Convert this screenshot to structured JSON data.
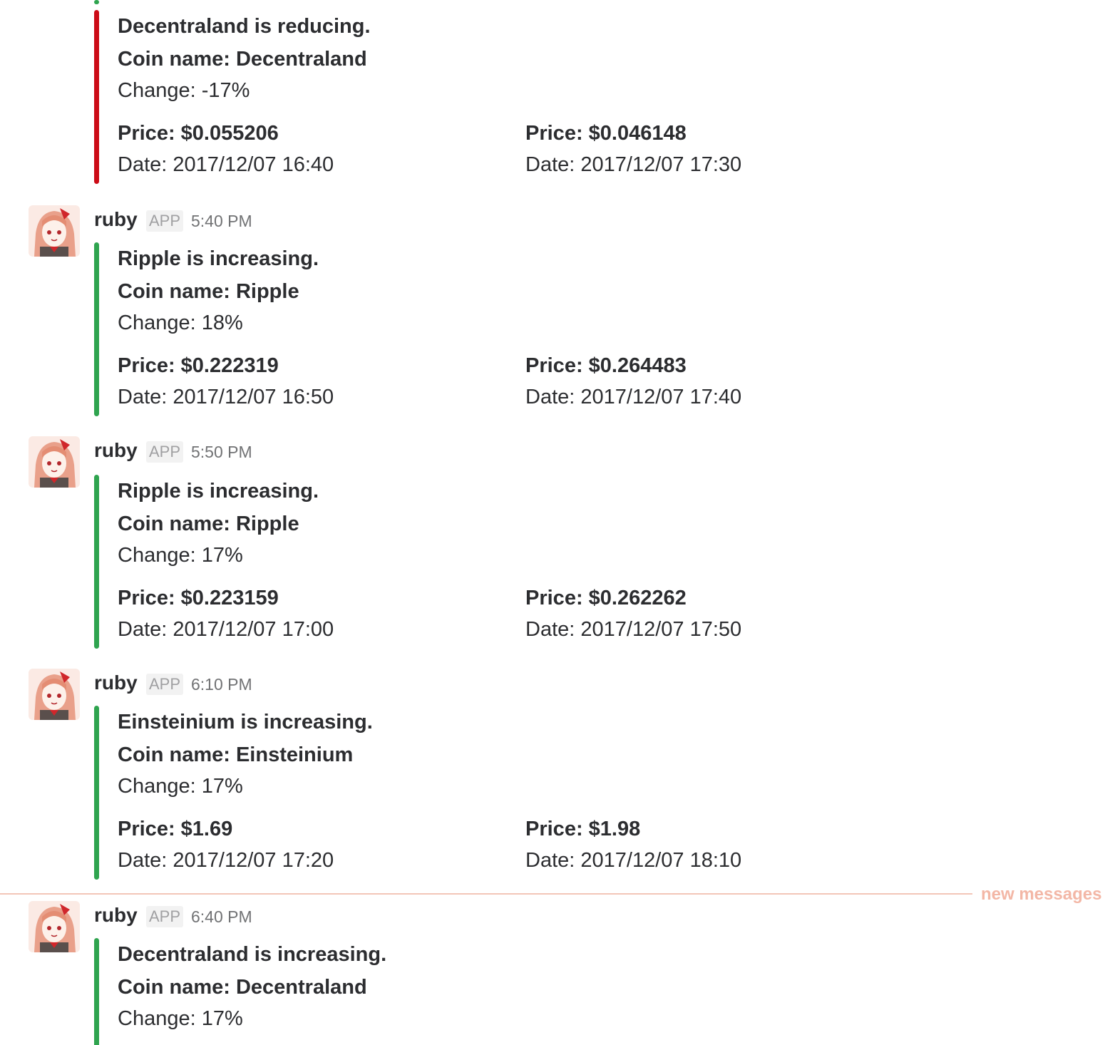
{
  "messages": [
    {
      "attachment_color": "#cc0c17",
      "title": "Decentraland is reducing.",
      "coin_line": "Coin name: Decentraland",
      "change_line": "Change: -17%",
      "price_from": "Price: $0.055206",
      "date_from": "Date: 2017/12/07 16:40",
      "price_to": "Price: $0.046148",
      "date_to": "Date: 2017/12/07 17:30"
    },
    {
      "author": "ruby",
      "badge": "APP",
      "time": "5:40 PM",
      "attachment_color": "#2fa44f",
      "title": "Ripple is increasing.",
      "coin_line": "Coin name: Ripple",
      "change_line": "Change: 18%",
      "price_from": "Price: $0.222319",
      "date_from": "Date: 2017/12/07 16:50",
      "price_to": "Price: $0.264483",
      "date_to": "Date: 2017/12/07 17:40"
    },
    {
      "author": "ruby",
      "badge": "APP",
      "time": "5:50 PM",
      "attachment_color": "#2fa44f",
      "title": "Ripple is increasing.",
      "coin_line": "Coin name: Ripple",
      "change_line": "Change: 17%",
      "price_from": "Price: $0.223159",
      "date_from": "Date: 2017/12/07 17:00",
      "price_to": "Price: $0.262262",
      "date_to": "Date: 2017/12/07 17:50"
    },
    {
      "author": "ruby",
      "badge": "APP",
      "time": "6:10 PM",
      "attachment_color": "#2fa44f",
      "title": "Einsteinium is increasing.",
      "coin_line": "Coin name: Einsteinium",
      "change_line": "Change: 17%",
      "price_from": "Price: $1.69",
      "date_from": "Date: 2017/12/07 17:20",
      "price_to": "Price: $1.98",
      "date_to": "Date: 2017/12/07 18:10"
    },
    {
      "author": "ruby",
      "badge": "APP",
      "time": "6:40 PM",
      "attachment_color": "#2fa44f",
      "title": "Decentraland is increasing.",
      "coin_line": "Coin name: Decentraland",
      "change_line": "Change: 17%"
    }
  ],
  "divider": {
    "label": "new messages",
    "color": "#f3b7a6"
  }
}
